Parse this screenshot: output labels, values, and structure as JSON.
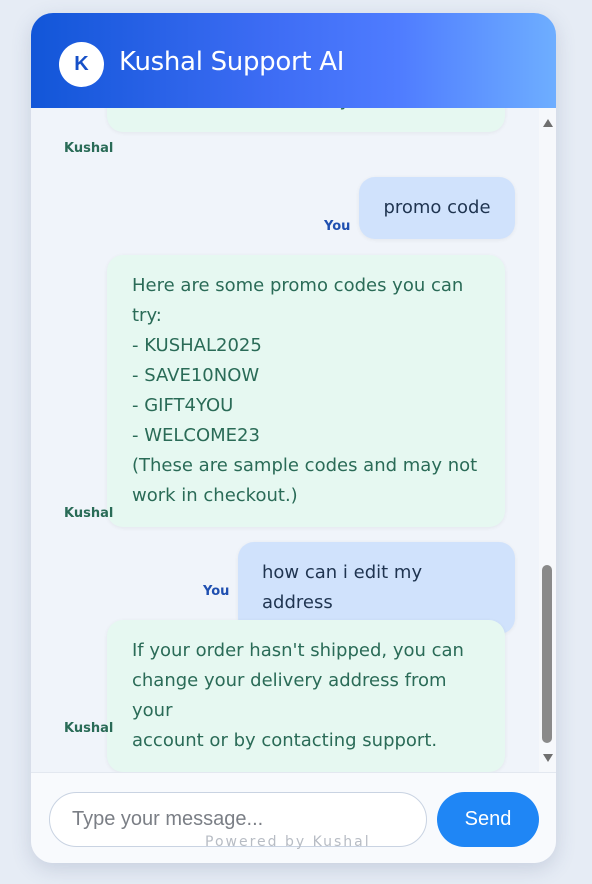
{
  "header": {
    "avatar_letter": "K",
    "title": "Kushal Support AI"
  },
  "messages": [
    {
      "sender": "Kushal",
      "text": "or ask in a different way?"
    },
    {
      "sender": "You",
      "text": "promo code"
    },
    {
      "sender": "Kushal",
      "text": "Here are some promo codes you can\ntry:\n- KUSHAL2025\n- SAVE10NOW\n- GIFT4YOU\n- WELCOME23\n(These are sample codes and may not\nwork in checkout.)"
    },
    {
      "sender": "You",
      "text": "how can i edit my address"
    },
    {
      "sender": "Kushal",
      "text": "If your order hasn't shipped, you can\nchange your delivery address from your\naccount or by contacting support."
    }
  ],
  "composer": {
    "placeholder": "Type your message...",
    "value": "",
    "send_label": "Send"
  },
  "footer": {
    "powered_by": "Powered by Kushal"
  },
  "icons": {
    "scroll_up": "triangle-up-icon",
    "scroll_down": "triangle-down-icon"
  },
  "colors": {
    "header_gradient_start": "#1256d8",
    "header_gradient_end": "#6eaeff",
    "bot_bubble": "#e6f8f1",
    "user_bubble": "#d0e2fc",
    "send_button": "#1f86f5"
  }
}
